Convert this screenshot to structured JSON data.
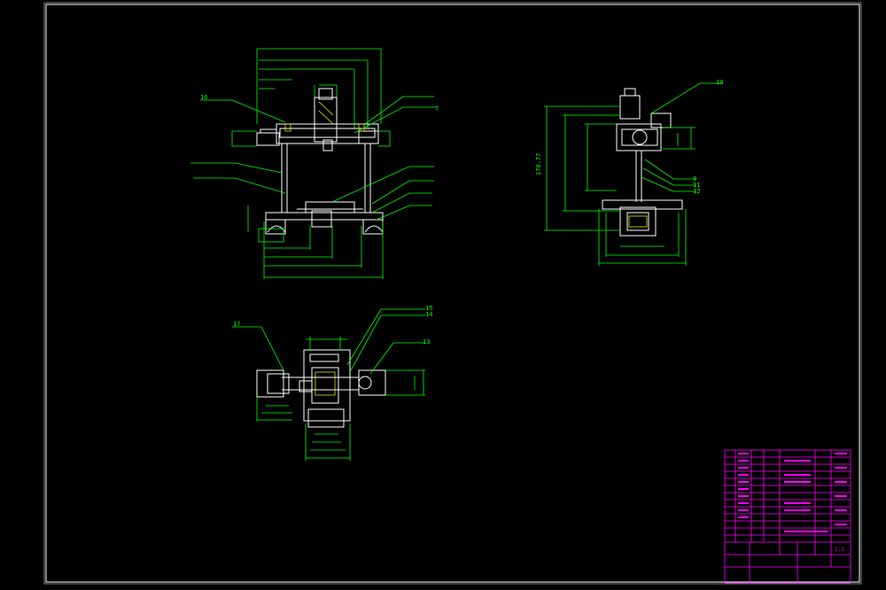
{
  "colors": {
    "background": "#000000",
    "frame": "#ffffff",
    "geometry": "#ffffff",
    "dimension": "#00ff00",
    "leader": "#00ff00",
    "title_block": "#ff00ff",
    "hatch": "#ffff00"
  },
  "front_view": {
    "part_labels": [
      "16",
      "7"
    ]
  },
  "side_view": {
    "part_labels": [
      "10",
      "9",
      "11",
      "12"
    ],
    "vertical_dimension": "170.77"
  },
  "top_view": {
    "part_labels": [
      "17",
      "15",
      "14",
      "13"
    ]
  },
  "title_block": {
    "scale": "1:1"
  }
}
